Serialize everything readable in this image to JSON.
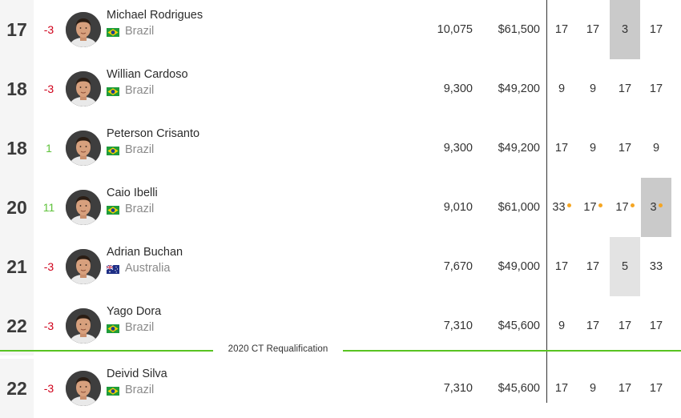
{
  "rows": [
    {
      "rank": "17",
      "change": "-3",
      "trend": "neg",
      "name": "Michael Rodrigues",
      "country": "Brazil",
      "flag": "brazil",
      "points": "10,075",
      "prize": "$61,500",
      "events": [
        {
          "v": "17"
        },
        {
          "v": "17"
        },
        {
          "v": "3",
          "hl": "dark"
        },
        {
          "v": "17"
        }
      ]
    },
    {
      "rank": "18",
      "change": "-3",
      "trend": "neg",
      "name": "Willian Cardoso",
      "country": "Brazil",
      "flag": "brazil",
      "points": "9,300",
      "prize": "$49,200",
      "events": [
        {
          "v": "9"
        },
        {
          "v": "9"
        },
        {
          "v": "17"
        },
        {
          "v": "17"
        }
      ]
    },
    {
      "rank": "18",
      "change": "1",
      "trend": "pos",
      "name": "Peterson Crisanto",
      "country": "Brazil",
      "flag": "brazil",
      "points": "9,300",
      "prize": "$49,200",
      "events": [
        {
          "v": "17"
        },
        {
          "v": "9"
        },
        {
          "v": "17"
        },
        {
          "v": "9"
        }
      ]
    },
    {
      "rank": "20",
      "change": "11",
      "trend": "pos",
      "name": "Caio Ibelli",
      "country": "Brazil",
      "flag": "brazil",
      "points": "9,010",
      "prize": "$61,000",
      "events": [
        {
          "v": "33",
          "dot": true
        },
        {
          "v": "17",
          "dot": true
        },
        {
          "v": "17",
          "dot": true
        },
        {
          "v": "3",
          "dot": true,
          "hl": "dark"
        }
      ]
    },
    {
      "rank": "21",
      "change": "-3",
      "trend": "neg",
      "name": "Adrian Buchan",
      "country": "Australia",
      "flag": "australia",
      "points": "7,670",
      "prize": "$49,000",
      "events": [
        {
          "v": "17"
        },
        {
          "v": "17"
        },
        {
          "v": "5",
          "hl": "light"
        },
        {
          "v": "33"
        }
      ]
    },
    {
      "rank": "22",
      "change": "-3",
      "trend": "neg",
      "name": "Yago Dora",
      "country": "Brazil",
      "flag": "brazil",
      "points": "7,310",
      "prize": "$45,600",
      "events": [
        {
          "v": "9"
        },
        {
          "v": "17"
        },
        {
          "v": "17"
        },
        {
          "v": "17"
        }
      ]
    },
    {
      "rank": "22",
      "change": "-3",
      "trend": "neg",
      "name": "Deivid Silva",
      "country": "Brazil",
      "flag": "brazil",
      "points": "7,310",
      "prize": "$45,600",
      "events": [
        {
          "v": "17"
        },
        {
          "v": "9"
        },
        {
          "v": "17"
        },
        {
          "v": "17"
        }
      ]
    }
  ],
  "cutline": {
    "label": "2020 CT Requalification"
  },
  "colors": {
    "negative": "#d0021b",
    "positive": "#5ec23a",
    "cutline": "#58c322",
    "dot": "#f5a623"
  }
}
